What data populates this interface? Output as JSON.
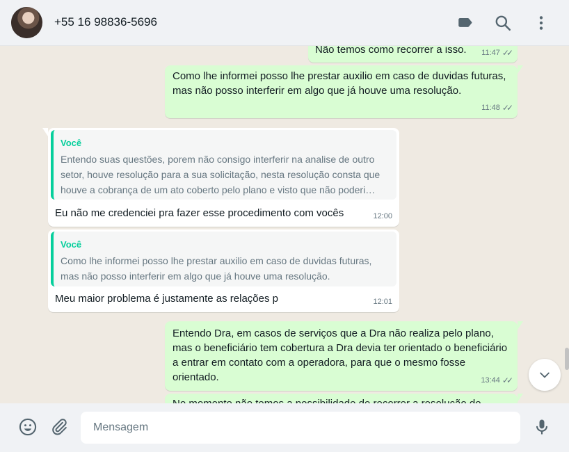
{
  "header": {
    "contact_name": "+55 16 98836-5696"
  },
  "messages": [
    {
      "dir": "out",
      "text": "Não temos como recorrer a isso.",
      "time": "11:47"
    },
    {
      "dir": "out",
      "text": "Como lhe informei posso lhe prestar auxilio em caso de duvidas futuras, mas não posso interferir em algo que já houve uma resolução.",
      "time": "11:48"
    },
    {
      "dir": "in",
      "quote_author": "Você",
      "quote_text": "Entendo suas questões, porem não consigo interferir na analise de outro setor, houve resolução para a sua solicitação, nesta resolução consta que houve a cobrança de um ato coberto pelo plano e visto que não poderi…",
      "text": "Eu não me credenciei pra fazer esse procedimento com vocês",
      "time": "12:00"
    },
    {
      "dir": "in",
      "quote_author": "Você",
      "quote_text": "Como lhe informei posso lhe prestar auxilio em caso de duvidas futuras, mas não posso interferir em algo que já houve uma resolução.",
      "text": "Meu maior problema é justamente as relações p",
      "time": "12:01"
    },
    {
      "dir": "out",
      "text": "Entendo Dra, em casos de serviços que a Dra não realiza pelo plano, mas o beneficiário tem cobertura a Dra devia ter orientado o beneficiário a entrar em contato com a operadora, para que o mesmo fosse orientado.",
      "time": "13:44"
    },
    {
      "dir": "out",
      "text": "No momento não temos a possibilidade de recorrer a resolução do",
      "time": ""
    }
  ],
  "ticks": "✓✓",
  "footer": {
    "input_placeholder": "Mensagem"
  },
  "colors": {
    "outgoing_bubble": "#d9fdd3",
    "incoming_bubble": "#ffffff",
    "quote_accent": "#06cf9c",
    "chat_background": "#efeae2",
    "header_background": "#f0f2f5"
  },
  "icons": {
    "header": [
      "label-icon",
      "search-icon",
      "menu-icon"
    ],
    "footer": [
      "emoji-icon",
      "attach-icon",
      "mic-icon"
    ],
    "scroll": "chevron-down-icon"
  }
}
